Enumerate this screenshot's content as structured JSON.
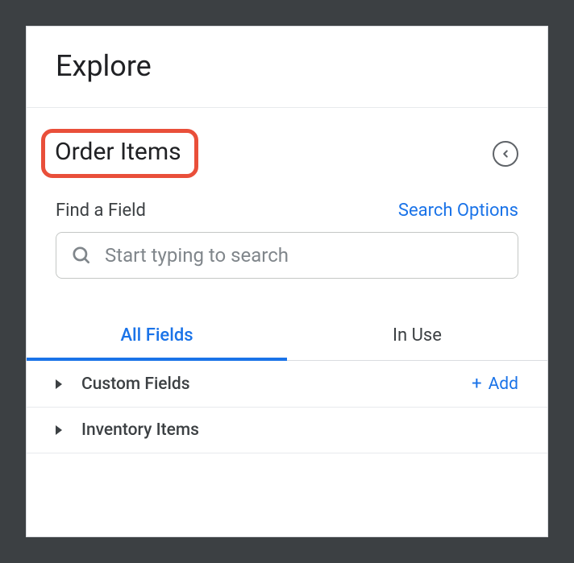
{
  "header": {
    "title": "Explore"
  },
  "section": {
    "title": "Order Items"
  },
  "search": {
    "findLabel": "Find a Field",
    "optionsLabel": "Search Options",
    "placeholder": "Start typing to search"
  },
  "tabs": {
    "allFields": "All Fields",
    "inUse": "In Use"
  },
  "fields": {
    "customFields": "Custom Fields",
    "inventoryItems": "Inventory Items",
    "addLabel": "Add"
  }
}
